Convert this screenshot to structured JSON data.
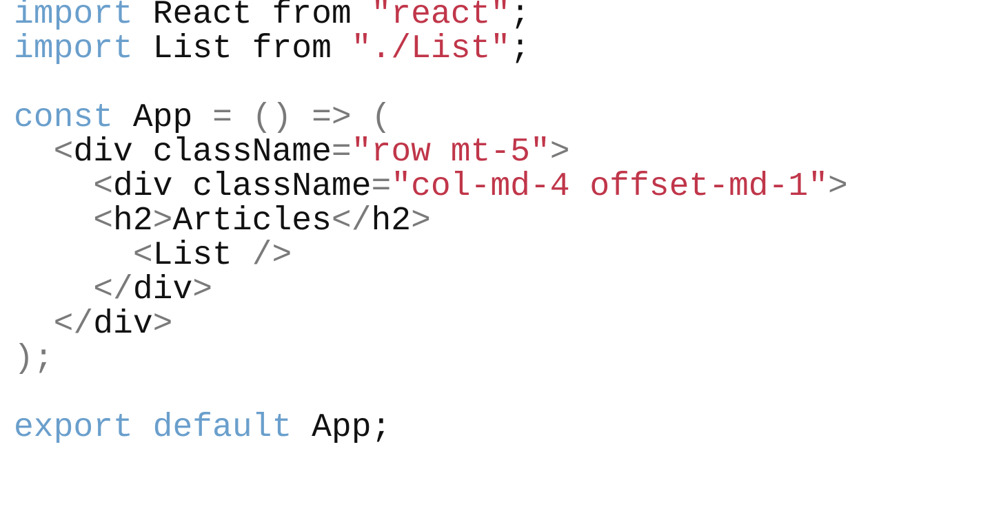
{
  "code": {
    "lines": [
      {
        "tokens": [
          {
            "t": "keyword",
            "v": "import"
          },
          {
            "t": "plain",
            "v": " React "
          },
          {
            "t": "plain",
            "v": "from"
          },
          {
            "t": "plain",
            "v": " "
          },
          {
            "t": "string",
            "v": "\"react\""
          },
          {
            "t": "plain",
            "v": ";"
          }
        ]
      },
      {
        "tokens": [
          {
            "t": "keyword",
            "v": "import"
          },
          {
            "t": "plain",
            "v": " List "
          },
          {
            "t": "plain",
            "v": "from"
          },
          {
            "t": "plain",
            "v": " "
          },
          {
            "t": "string",
            "v": "\"./List\""
          },
          {
            "t": "plain",
            "v": ";"
          }
        ]
      },
      {
        "tokens": []
      },
      {
        "tokens": [
          {
            "t": "keyword",
            "v": "const"
          },
          {
            "t": "plain",
            "v": " App "
          },
          {
            "t": "punct",
            "v": "= () => ("
          }
        ]
      },
      {
        "tokens": [
          {
            "t": "plain",
            "v": "  "
          },
          {
            "t": "punct",
            "v": "<"
          },
          {
            "t": "plain",
            "v": "div className"
          },
          {
            "t": "punct",
            "v": "="
          },
          {
            "t": "string",
            "v": "\"row mt-5\""
          },
          {
            "t": "punct",
            "v": ">"
          }
        ]
      },
      {
        "tokens": [
          {
            "t": "plain",
            "v": "    "
          },
          {
            "t": "punct",
            "v": "<"
          },
          {
            "t": "plain",
            "v": "div className"
          },
          {
            "t": "punct",
            "v": "="
          },
          {
            "t": "string",
            "v": "\"col-md-4 offset-md-1\""
          },
          {
            "t": "punct",
            "v": ">"
          }
        ]
      },
      {
        "tokens": [
          {
            "t": "plain",
            "v": "    "
          },
          {
            "t": "punct",
            "v": "<"
          },
          {
            "t": "plain",
            "v": "h2"
          },
          {
            "t": "punct",
            "v": ">"
          },
          {
            "t": "plain",
            "v": "Articles"
          },
          {
            "t": "punct",
            "v": "</"
          },
          {
            "t": "plain",
            "v": "h2"
          },
          {
            "t": "punct",
            "v": ">"
          }
        ]
      },
      {
        "tokens": [
          {
            "t": "plain",
            "v": "      "
          },
          {
            "t": "punct",
            "v": "<"
          },
          {
            "t": "plain",
            "v": "List "
          },
          {
            "t": "punct",
            "v": "/>"
          }
        ]
      },
      {
        "tokens": [
          {
            "t": "plain",
            "v": "    "
          },
          {
            "t": "punct",
            "v": "</"
          },
          {
            "t": "plain",
            "v": "div"
          },
          {
            "t": "punct",
            "v": ">"
          }
        ]
      },
      {
        "tokens": [
          {
            "t": "plain",
            "v": "  "
          },
          {
            "t": "punct",
            "v": "</"
          },
          {
            "t": "plain",
            "v": "div"
          },
          {
            "t": "punct",
            "v": ">"
          }
        ]
      },
      {
        "tokens": [
          {
            "t": "punct",
            "v": ");"
          }
        ]
      },
      {
        "tokens": []
      },
      {
        "tokens": [
          {
            "t": "keyword",
            "v": "export"
          },
          {
            "t": "plain",
            "v": " "
          },
          {
            "t": "keyword",
            "v": "default"
          },
          {
            "t": "plain",
            "v": " App;"
          }
        ]
      }
    ]
  },
  "colors": {
    "keyword": "#6a9fcc",
    "string": "#c0364a",
    "punct": "#7a7a7a",
    "plain": "#111111"
  }
}
